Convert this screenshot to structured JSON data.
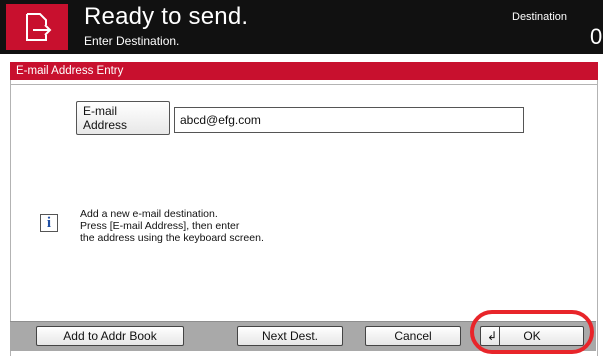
{
  "header": {
    "title": "Ready to send.",
    "subtitle": "Enter Destination.",
    "destination_label": "Destination",
    "destination_count": "0",
    "accent_color": "#c8102e"
  },
  "panel": {
    "title": "E-mail Address Entry"
  },
  "email": {
    "button_line1": "E-mail",
    "button_line2": "Address",
    "value": "abcd@efg.com"
  },
  "info": {
    "icon": "info-icon",
    "lines": [
      "Add a new e-mail destination.",
      "Press [E-mail Address], then enter",
      "the address using the keyboard screen."
    ]
  },
  "buttons": {
    "add_to_addr_book": "Add to Addr Book",
    "next_dest": "Next Dest.",
    "cancel": "Cancel",
    "ok": "OK"
  },
  "highlight_color": "#e8252a"
}
